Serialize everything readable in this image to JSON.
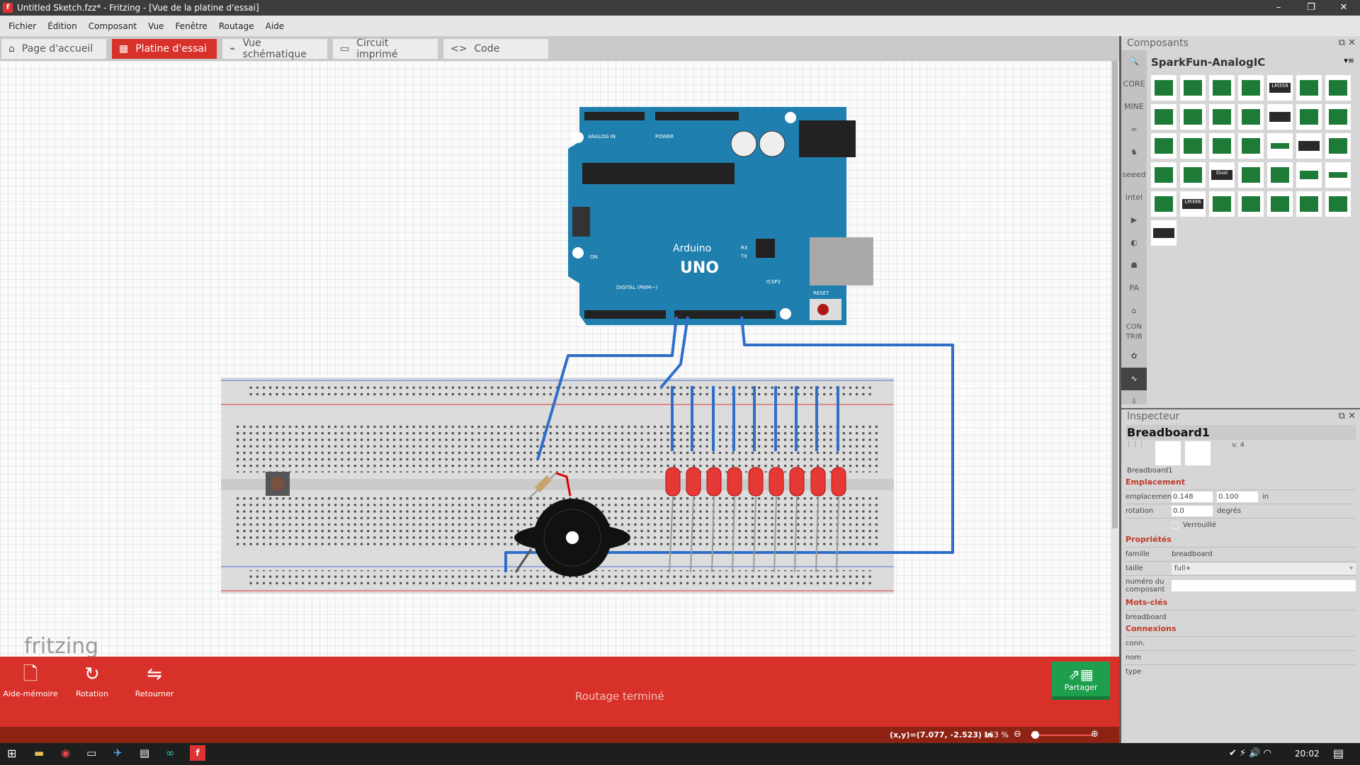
{
  "window": {
    "title": "Untitled Sketch.fzz* - Fritzing - [Vue de la platine d'essai]",
    "logo": "f",
    "controls": [
      "–",
      "❐",
      "✕"
    ]
  },
  "menu": [
    "Fichier",
    "Édition",
    "Composant",
    "Vue",
    "Fenêtre",
    "Routage",
    "Aide"
  ],
  "tabs": [
    {
      "label": "Page d'accueil",
      "icon": "home-icon"
    },
    {
      "label": "Platine d'essai",
      "icon": "breadboard-icon",
      "active": true
    },
    {
      "label": "Vue schématique",
      "icon": "schematic-icon"
    },
    {
      "label": "Circuit imprimé",
      "icon": "pcb-icon"
    },
    {
      "label": "Code",
      "icon": "code-icon"
    }
  ],
  "canvas": {
    "watermark": "fritzing",
    "arduino": {
      "brand": "Arduino",
      "model": "UNO",
      "labels": [
        "ANALOG IN",
        "POWER",
        "DIGITAL (PWM~)",
        "ICSP",
        "ICSP2",
        "RESET",
        "ON",
        "TX",
        "RX",
        "L"
      ]
    }
  },
  "toolbar": {
    "items": [
      {
        "label": "Aide-mémoire",
        "icon": "note-icon"
      },
      {
        "label": "Rotation",
        "icon": "rotate-icon"
      },
      {
        "label": "Retourner",
        "icon": "flip-icon"
      }
    ],
    "status": "Routage terminé",
    "share": "Partager"
  },
  "statusbar": {
    "coords": "(x,y)=(7.077, -2.523) in",
    "zoom": "163 %",
    "zoom_level": 0.1
  },
  "parts": {
    "title": "Composants",
    "category": "SparkFun-AnalogIC",
    "bins": [
      "CORE",
      "MINE",
      "∞",
      "♞",
      "seeed",
      "intel",
      "▶",
      "◐",
      "☗",
      "PA",
      "⌂",
      "CON TRIB",
      "✿",
      "∿",
      "⇩"
    ],
    "chip_labels": [
      "LM358",
      "Dual",
      "LM386"
    ]
  },
  "inspector": {
    "title": "Inspecteur",
    "name": "Breadboard1",
    "version": "v. 4",
    "caption": "Breadboard1",
    "sections": {
      "location": "Emplacement",
      "properties": "Propriétés",
      "tags": "Mots-clés",
      "connections": "Connexions"
    },
    "location_label": "emplacemen",
    "x": "0.148",
    "y": "0.100",
    "unit": "in",
    "rotation_label": "rotation",
    "rotation": "0.0",
    "rotation_unit": "degrés",
    "locked": "Verrouillé",
    "family_label": "famille",
    "family": "breadboard",
    "size_label": "taille",
    "size": "full+",
    "part_number_label": "numéro du composant",
    "part_number": "",
    "tags": "breadboard",
    "conn": "conn.",
    "name_label": "nom",
    "type_label": "type"
  },
  "taskbar": {
    "time": "20:02"
  },
  "colors": {
    "accent": "#d8312a",
    "wire": "#2f6fc9",
    "share": "#1e9f4d",
    "arduino": "#1f7fae"
  }
}
